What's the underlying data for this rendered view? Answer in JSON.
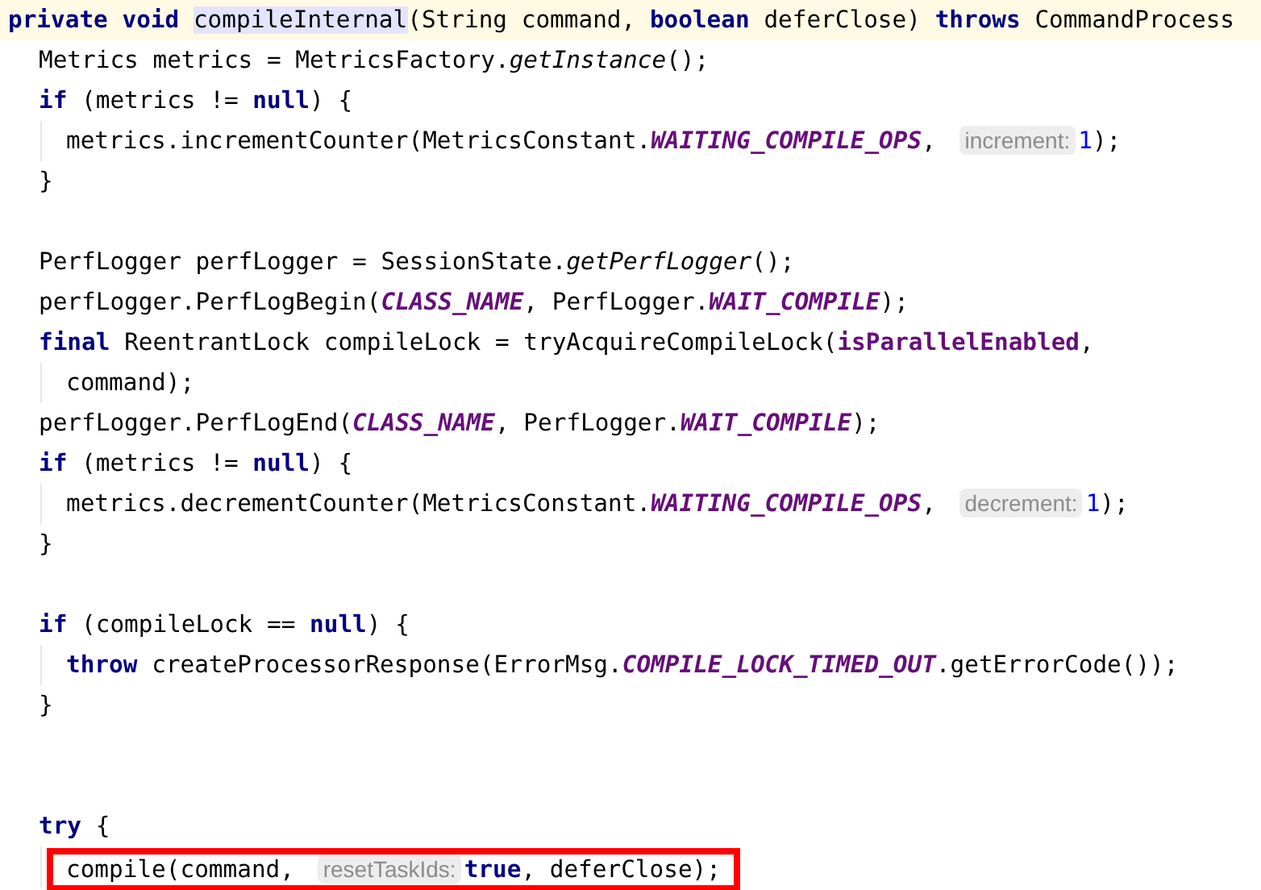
{
  "code_lines": [
    {
      "kind": "caret",
      "tokens": [
        {
          "kind": "kw",
          "text": "private void "
        },
        {
          "kind": "usage",
          "text": "compileInternal"
        },
        {
          "kind": "plain",
          "text": "(String command, "
        },
        {
          "kind": "kw",
          "text": "boolean "
        },
        {
          "kind": "plain",
          "text": "deferClose) "
        },
        {
          "kind": "kw",
          "text": "throws "
        },
        {
          "kind": "plain",
          "text": "CommandProcess"
        }
      ],
      "children": [
        {
          "kind": "code",
          "tokens": [
            {
              "kind": "plain",
              "text": "Metrics metrics = MetricsFactory."
            },
            {
              "kind": "italic",
              "text": "getInstance"
            },
            {
              "kind": "plain",
              "text": "();"
            }
          ]
        },
        {
          "kind": "code",
          "tokens": [
            {
              "kind": "kw",
              "text": "if "
            },
            {
              "kind": "plain",
              "text": "(metrics != "
            },
            {
              "kind": "kw",
              "text": "null"
            },
            {
              "kind": "plain",
              "text": ") {"
            }
          ],
          "children": [
            {
              "kind": "code",
              "tokens": [
                {
                  "kind": "plain",
                  "text": "metrics.incrementCounter(MetricsConstant."
                },
                {
                  "kind": "const",
                  "text": "WAITING_COMPILE_OPS"
                },
                {
                  "kind": "plain",
                  "text": ", "
                },
                {
                  "kind": "hint",
                  "text": "increment:"
                },
                {
                  "kind": "num",
                  "text": "1"
                },
                {
                  "kind": "plain",
                  "text": ");"
                }
              ]
            }
          ]
        },
        {
          "kind": "code",
          "tokens": [
            {
              "kind": "plain",
              "text": "}"
            }
          ]
        },
        {
          "kind": "blank"
        },
        {
          "kind": "code",
          "tokens": [
            {
              "kind": "plain",
              "text": "PerfLogger perfLogger = SessionState."
            },
            {
              "kind": "italic",
              "text": "getPerfLogger"
            },
            {
              "kind": "plain",
              "text": "();"
            }
          ]
        },
        {
          "kind": "code",
          "tokens": [
            {
              "kind": "plain",
              "text": "perfLogger.PerfLogBegin("
            },
            {
              "kind": "const",
              "text": "CLASS_NAME"
            },
            {
              "kind": "plain",
              "text": ", PerfLogger."
            },
            {
              "kind": "const",
              "text": "WAIT_COMPILE"
            },
            {
              "kind": "plain",
              "text": ");"
            }
          ]
        },
        {
          "kind": "code",
          "tokens": [
            {
              "kind": "kw",
              "text": "final "
            },
            {
              "kind": "plain",
              "text": "ReentrantLock compileLock = tryAcquireCompileLock("
            },
            {
              "kind": "field",
              "text": "isParallelEnabled"
            },
            {
              "kind": "plain",
              "text": ","
            }
          ],
          "children": [
            {
              "kind": "code",
              "tokens": [
                {
                  "kind": "plain",
                  "text": "command);"
                }
              ]
            }
          ]
        },
        {
          "kind": "code",
          "tokens": [
            {
              "kind": "plain",
              "text": "perfLogger.PerfLogEnd("
            },
            {
              "kind": "const",
              "text": "CLASS_NAME"
            },
            {
              "kind": "plain",
              "text": ", PerfLogger."
            },
            {
              "kind": "const",
              "text": "WAIT_COMPILE"
            },
            {
              "kind": "plain",
              "text": ");"
            }
          ]
        },
        {
          "kind": "code",
          "tokens": [
            {
              "kind": "kw",
              "text": "if "
            },
            {
              "kind": "plain",
              "text": "(metrics != "
            },
            {
              "kind": "kw",
              "text": "null"
            },
            {
              "kind": "plain",
              "text": ") {"
            }
          ],
          "children": [
            {
              "kind": "code",
              "tokens": [
                {
                  "kind": "plain",
                  "text": "metrics.decrementCounter(MetricsConstant."
                },
                {
                  "kind": "const",
                  "text": "WAITING_COMPILE_OPS"
                },
                {
                  "kind": "plain",
                  "text": ", "
                },
                {
                  "kind": "hint",
                  "text": "decrement:"
                },
                {
                  "kind": "num",
                  "text": "1"
                },
                {
                  "kind": "plain",
                  "text": ");"
                }
              ]
            }
          ]
        },
        {
          "kind": "code",
          "tokens": [
            {
              "kind": "plain",
              "text": "}"
            }
          ]
        },
        {
          "kind": "blank"
        },
        {
          "kind": "code",
          "tokens": [
            {
              "kind": "kw",
              "text": "if "
            },
            {
              "kind": "plain",
              "text": "(compileLock == "
            },
            {
              "kind": "kw",
              "text": "null"
            },
            {
              "kind": "plain",
              "text": ") {"
            }
          ],
          "children": [
            {
              "kind": "code",
              "tokens": [
                {
                  "kind": "kw",
                  "text": "throw "
                },
                {
                  "kind": "plain",
                  "text": "createProcessorResponse(ErrorMsg."
                },
                {
                  "kind": "const",
                  "text": "COMPILE_LOCK_TIMED_OUT"
                },
                {
                  "kind": "plain",
                  "text": ".getErrorCode());"
                }
              ]
            }
          ]
        },
        {
          "kind": "code",
          "tokens": [
            {
              "kind": "plain",
              "text": "}"
            }
          ]
        },
        {
          "kind": "blank"
        },
        {
          "kind": "blank"
        },
        {
          "kind": "code",
          "tokens": [
            {
              "kind": "kw",
              "text": "try "
            },
            {
              "kind": "plain",
              "text": "{"
            }
          ],
          "children": [
            {
              "kind": "boxed",
              "tokens": [
                {
                  "kind": "plain",
                  "text": "compile(command, "
                },
                {
                  "kind": "hint",
                  "text": "resetTaskIds:"
                },
                {
                  "kind": "kw",
                  "text": "true"
                },
                {
                  "kind": "plain",
                  "text": ", deferClose);"
                }
              ]
            }
          ]
        }
      ]
    }
  ]
}
